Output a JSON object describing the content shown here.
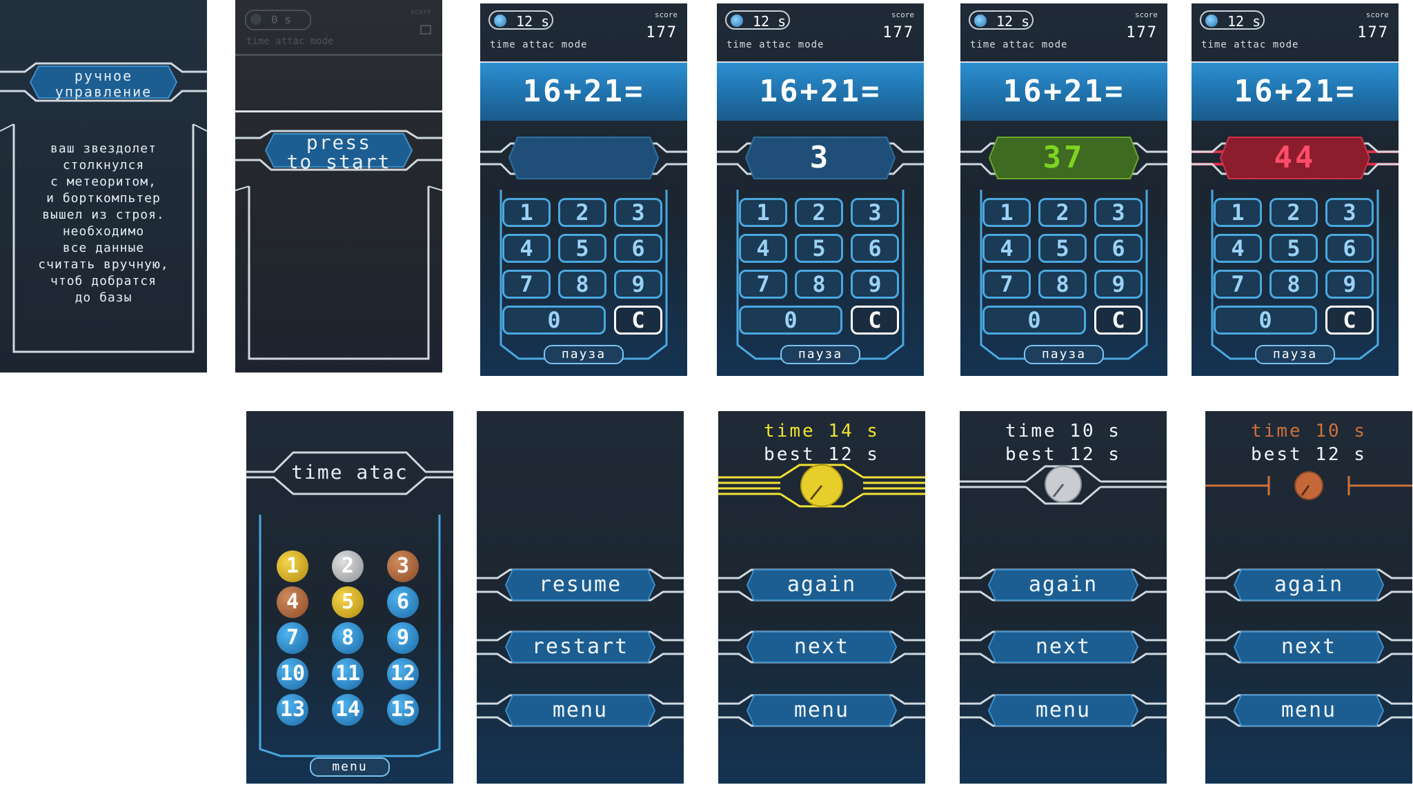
{
  "colors": {
    "accent_blue": "#2d8fd0",
    "key_border": "#4aa8e0",
    "correct_green": "#7ed321",
    "wrong_red": "#ff4d6a",
    "gold": "#f2e232",
    "bronze": "#d0703c"
  },
  "intro": {
    "title_line1": "ручное",
    "title_line2": "управление",
    "story": [
      "ваш звездолет",
      "столкнулся",
      "с метеоритом,",
      "и борткомпьтер",
      "вышел из строя.",
      "необходимо",
      "все данные",
      "считать вручную,",
      "чтоб добратся",
      "до базы"
    ]
  },
  "start": {
    "timer": "0 s",
    "score_label": "score",
    "mode": "time attac mode",
    "press_line1": "press",
    "press_line2": "to start"
  },
  "game": {
    "timer": "12 s",
    "score_label": "score",
    "score": "177",
    "mode": "time attac mode",
    "equation": "16+21=",
    "answers": [
      "",
      "3",
      "37",
      "44"
    ],
    "keys": [
      "1",
      "2",
      "3",
      "4",
      "5",
      "6",
      "7",
      "8",
      "9"
    ],
    "zero": "0",
    "clear": "C",
    "pause": "пауза"
  },
  "levels": {
    "title": "time atac",
    "items": [
      "1",
      "2",
      "3",
      "4",
      "5",
      "6",
      "7",
      "8",
      "9",
      "10",
      "11",
      "12",
      "13",
      "14",
      "15"
    ],
    "menu": "menu"
  },
  "pause_menu": {
    "resume": "resume",
    "restart": "restart",
    "menu": "menu"
  },
  "results": [
    {
      "time_label": "time",
      "time_value": "14",
      "best_label": "best",
      "best_value": "12",
      "unit": "s",
      "again": "again",
      "next": "next",
      "menu": "menu"
    },
    {
      "time_label": "time",
      "time_value": "10",
      "best_label": "best",
      "best_value": "12",
      "unit": "s",
      "again": "again",
      "next": "next",
      "menu": "menu"
    },
    {
      "time_label": "time",
      "time_value": "10",
      "best_label": "best",
      "best_value": "12",
      "unit": "s",
      "again": "again",
      "next": "next",
      "menu": "menu"
    }
  ]
}
